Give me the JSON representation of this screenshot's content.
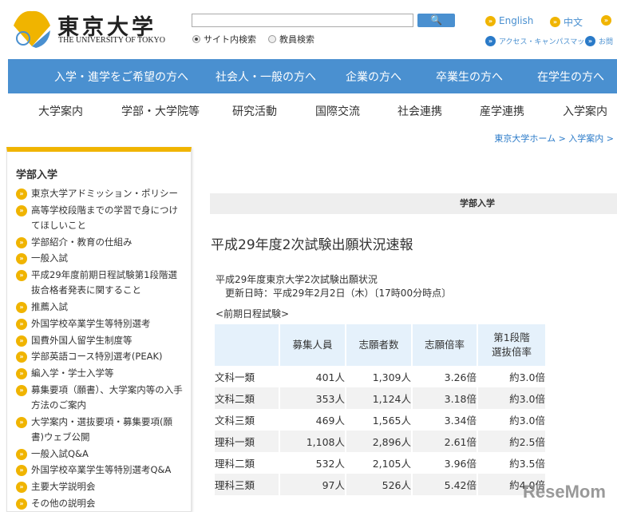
{
  "header": {
    "logo_jp": "東京大学",
    "logo_en": "THE UNIVERSITY OF TOKYO",
    "search_placeholder": "",
    "search_button_icon": "search-icon",
    "radio_site": "サイト内検索",
    "radio_faculty": "教員検索",
    "radio_selected": "site",
    "lang_links": [
      "English",
      "中文"
    ],
    "links": [
      "アクセス・キャンパスマップ",
      "お問"
    ]
  },
  "nav_primary": [
    "入学・進学をご希望の方へ",
    "社会人・一般の方へ",
    "企業の方へ",
    "卒業生の方へ",
    "在学生の方へ"
  ],
  "nav_secondary": [
    "大学案内",
    "学部・大学院等",
    "研究活動",
    "国際交流",
    "社会連携",
    "産学連携",
    "入学案内"
  ],
  "breadcrumb": "東京大学ホーム > 入学案内 >",
  "sidebar": {
    "title": "学部入学",
    "items": [
      "東京大学アドミッション・ポリシー",
      "高等学校段階までの学習で身につけてほしいこと",
      "学部紹介・教育の仕組み",
      "一般入試",
      "平成29年度前期日程試験第1段階選抜合格者発表に関すること",
      "推薦入試",
      "外国学校卒業学生等特別選考",
      "国費外国人留学生制度等",
      "学部英語コース特別選考(PEAK)",
      "編入学・学士入学等",
      "募集要項（願書）、大学案内等の入手方法のご案内",
      "大学案内・選抜要項・募集要項(願書)ウェブ公開",
      "一般入試Q&A",
      "外国学校卒業学生等特別選考Q&A",
      "主要大学説明会",
      "その他の説明会"
    ]
  },
  "main": {
    "section_bar": "学部入学",
    "title": "平成29年度2次試験出願状況速報",
    "subtitle": "平成29年度東京大学2次試験出願状況",
    "updated": "更新日時：平成29年2月2日（木）〔17時00分時点〕",
    "exam_label": "<前期日程試験>",
    "table": {
      "headers": [
        "",
        "募集人員",
        "志願者数",
        "志願倍率",
        "第1段階選抜倍率"
      ],
      "rows": [
        [
          "文科一類",
          "401人",
          "1,309人",
          "3.26倍",
          "約3.0倍"
        ],
        [
          "文科二類",
          "353人",
          "1,124人",
          "3.18倍",
          "約3.0倍"
        ],
        [
          "文科三類",
          "469人",
          "1,565人",
          "3.34倍",
          "約3.0倍"
        ],
        [
          "理科一類",
          "1,108人",
          "2,896人",
          "2.61倍",
          "約2.5倍"
        ],
        [
          "理科二類",
          "532人",
          "2,105人",
          "3.96倍",
          "約3.5倍"
        ],
        [
          "理科三類",
          "97人",
          "526人",
          "5.42倍",
          "約4.0倍"
        ]
      ]
    }
  },
  "watermark": "ReseMom",
  "colors": {
    "nav_blue": "#4a90d0",
    "accent_yellow": "#f0b400"
  }
}
